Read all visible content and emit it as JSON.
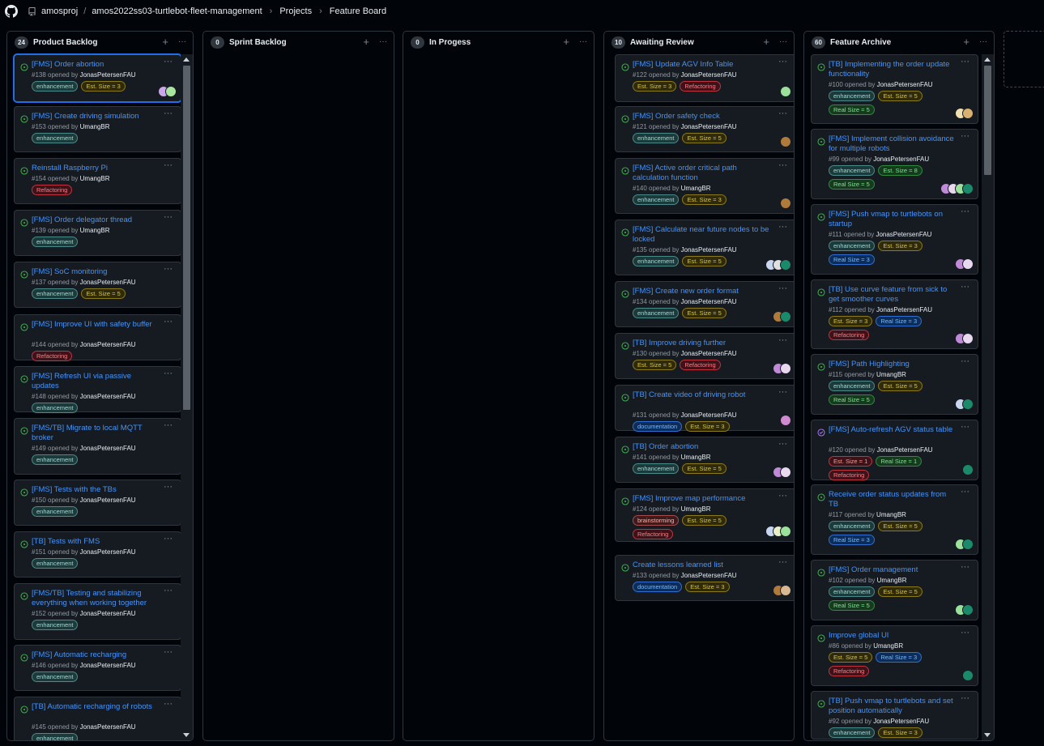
{
  "header": {
    "owner": "amosproj",
    "repo": "amos2022ss03-turtlebot-fleet-management",
    "crumbs": [
      "Projects",
      "Feature Board"
    ]
  },
  "columns": [
    {
      "count": "24",
      "title": "Product Backlog",
      "cards": [
        {
          "title": "[FMS] Order abortion",
          "num": "#138",
          "author": "JonasPetersenFAU",
          "labels": [
            [
              "enhancement",
              "enh"
            ],
            [
              "Est. Size = 3",
              "est"
            ]
          ],
          "avatars": [
            "#c9a7e8",
            "#a8e6a0"
          ]
        },
        {
          "title": "[FMS] Create driving simulation",
          "num": "#153",
          "author": "UmangBR",
          "labels": [
            [
              "enhancement",
              "enh"
            ]
          ],
          "avatars": []
        },
        {
          "title": "Reinstall Raspberry Pi",
          "num": "#154",
          "author": "UmangBR",
          "labels": [
            [
              "Refactoring",
              "ref"
            ]
          ],
          "avatars": []
        },
        {
          "title": "[FMS] Order delegator thread",
          "num": "#139",
          "author": "UmangBR",
          "labels": [
            [
              "enhancement",
              "enh"
            ]
          ],
          "avatars": []
        },
        {
          "title": "[FMS] SoC monitoring",
          "num": "#137",
          "author": "JonasPetersenFAU",
          "labels": [
            [
              "enhancement",
              "enh"
            ],
            [
              "Est. Size = 5",
              "est"
            ]
          ],
          "avatars": []
        },
        {
          "title": "[FMS] Improve UI with safety buffer",
          "num": "#144",
          "author": "JonasPetersenFAU",
          "labels": [
            [
              "Refactoring",
              "ref"
            ]
          ],
          "avatars": []
        },
        {
          "title": "[FMS] Refresh UI via passive updates",
          "num": "#148",
          "author": "JonasPetersenFAU",
          "labels": [
            [
              "enhancement",
              "enh"
            ]
          ],
          "avatars": []
        },
        {
          "title": "[FMS/TB] Migrate to local MQTT broker",
          "num": "#149",
          "author": "JonasPetersenFAU",
          "labels": [
            [
              "enhancement",
              "enh"
            ]
          ],
          "avatars": []
        },
        {
          "title": "[FMS] Tests with the TBs",
          "num": "#150",
          "author": "JonasPetersenFAU",
          "labels": [
            [
              "enhancement",
              "enh"
            ]
          ],
          "avatars": []
        },
        {
          "title": "[TB] Tests with FMS",
          "num": "#151",
          "author": "JonasPetersenFAU",
          "labels": [
            [
              "enhancement",
              "enh"
            ]
          ],
          "avatars": []
        },
        {
          "title": "[FMS/TB] Testing and stabilizing everything when working together",
          "num": "#152",
          "author": "JonasPetersenFAU",
          "labels": [
            [
              "enhancement",
              "enh"
            ]
          ],
          "avatars": []
        },
        {
          "title": "[FMS] Automatic recharging",
          "num": "#146",
          "author": "JonasPetersenFAU",
          "labels": [
            [
              "enhancement",
              "enh"
            ]
          ],
          "avatars": []
        },
        {
          "title": "[TB] Automatic recharging of robots",
          "num": "#145",
          "author": "JonasPetersenFAU",
          "labels": [
            [
              "enhancement",
              "enh"
            ]
          ],
          "avatars": []
        }
      ]
    },
    {
      "count": "0",
      "title": "Sprint Backlog",
      "cards": []
    },
    {
      "count": "0",
      "title": "In Progess",
      "cards": []
    },
    {
      "count": "10",
      "title": "Awaiting Review",
      "cards": [
        {
          "title": "[FMS] Update AGV Info Table",
          "num": "#122",
          "author": "JonasPetersenFAU",
          "labels": [
            [
              "Est. Size = 3",
              "est"
            ],
            [
              "Refactoring",
              "ref"
            ]
          ],
          "avatars": [
            "#9be09b"
          ]
        },
        {
          "title": "[FMS] Order safety check",
          "num": "#121",
          "author": "JonasPetersenFAU",
          "labels": [
            [
              "enhancement",
              "enh"
            ],
            [
              "Est. Size = 5",
              "est"
            ]
          ],
          "avatars": [
            "#b07a3a"
          ]
        },
        {
          "title": "[FMS] Active order critical path calculation function",
          "num": "#140",
          "author": "UmangBR",
          "labels": [
            [
              "enhancement",
              "enh"
            ],
            [
              "Est. Size = 3",
              "est"
            ]
          ],
          "avatars": [
            "#b07a3a"
          ]
        },
        {
          "title": "[FMS] Calculate near future nodes to be locked",
          "num": "#135",
          "author": "JonasPetersenFAU",
          "labels": [
            [
              "enhancement",
              "enh"
            ],
            [
              "Est. Size = 5",
              "est"
            ]
          ],
          "avatars": [
            "#c9d6f0",
            "#e0e0e0",
            "#1a8a6a"
          ]
        },
        {
          "title": "[FMS] Create new order format",
          "num": "#134",
          "author": "JonasPetersenFAU",
          "labels": [
            [
              "enhancement",
              "enh"
            ],
            [
              "Est. Size = 5",
              "est"
            ]
          ],
          "avatars": [
            "#b07a3a",
            "#1a8a6a"
          ]
        },
        {
          "title": "[TB] Improve driving further",
          "num": "#130",
          "author": "JonasPetersenFAU",
          "labels": [
            [
              "Est. Size = 5",
              "est"
            ],
            [
              "Refactoring",
              "ref"
            ]
          ],
          "avatars": [
            "#c08ad8",
            "#e8d8f0"
          ]
        },
        {
          "title": "[TB] Create video of driving robot",
          "num": "#131",
          "author": "JonasPetersenFAU",
          "labels": [
            [
              "documentation",
              "doc"
            ],
            [
              "Est. Size = 3",
              "est"
            ]
          ],
          "avatars": [
            "#d08ad0"
          ]
        },
        {
          "title": "[TB] Order abortion",
          "num": "#141",
          "author": "UmangBR",
          "labels": [
            [
              "enhancement",
              "enh"
            ],
            [
              "Est. Size = 5",
              "est"
            ]
          ],
          "avatars": [
            "#c08ad8",
            "#e8d8f0"
          ]
        },
        {
          "title": "[FMS] Improve map performance",
          "num": "#124",
          "author": "UmangBR",
          "labels": [
            [
              "brainstorming",
              "brain"
            ],
            [
              "Est. Size = 5",
              "est"
            ],
            [
              "Refactoring",
              "ref"
            ]
          ],
          "avatars": [
            "#c9d6f0",
            "#e8f0c9",
            "#9be09b"
          ]
        },
        {
          "title": "Create lessons learned list",
          "num": "#133",
          "author": "JonasPetersenFAU",
          "labels": [
            [
              "documentation",
              "doc"
            ],
            [
              "Est. Size = 3",
              "est"
            ]
          ],
          "avatars": [
            "#b07a3a",
            "#d8b890"
          ]
        }
      ]
    },
    {
      "count": "60",
      "title": "Feature Archive",
      "cards": [
        {
          "title": "[TB] Implementing the order update functionality",
          "num": "#100",
          "author": "JonasPetersenFAU",
          "labels": [
            [
              "enhancement",
              "enh"
            ],
            [
              "Est. Size = 5",
              "est"
            ],
            [
              "Real Size = 5",
              "realg"
            ]
          ],
          "avatars": [
            "#f0e0b0",
            "#d8b070"
          ]
        },
        {
          "title": "[FMS] Implement collision avoidance for multiple robots",
          "num": "#99",
          "author": "JonasPetersenFAU",
          "labels": [
            [
              "enhancement",
              "enh"
            ],
            [
              "Est. Size = 8",
              "realg"
            ],
            [
              "Real Size = 5",
              "realg"
            ]
          ],
          "avatars": [
            "#c08ad8",
            "#e8d8f0",
            "#9be09b",
            "#1a8a6a"
          ]
        },
        {
          "title": "[FMS] Push vmap to turtlebots on startup",
          "num": "#111",
          "author": "JonasPetersenFAU",
          "labels": [
            [
              "enhancement",
              "enh"
            ],
            [
              "Est. Size = 3",
              "est"
            ],
            [
              "Real Size = 3",
              "realb"
            ]
          ],
          "avatars": [
            "#c08ad8",
            "#e8d8f0"
          ]
        },
        {
          "title": "[TB] Use curve feature from sick to get smoother curves",
          "num": "#112",
          "author": "JonasPetersenFAU",
          "labels": [
            [
              "Est. Size = 3",
              "est"
            ],
            [
              "Real Size = 3",
              "realb"
            ],
            [
              "Refactoring",
              "ref"
            ]
          ],
          "avatars": [
            "#c08ad8",
            "#e8d8f0"
          ]
        },
        {
          "title": "[FMS] Path Highlighting",
          "num": "#115",
          "author": "UmangBR",
          "labels": [
            [
              "enhancement",
              "enh"
            ],
            [
              "Est. Size = 5",
              "est"
            ],
            [
              "Real Size = 5",
              "realg"
            ]
          ],
          "avatars": [
            "#c9d6f0",
            "#1a8a6a"
          ]
        },
        {
          "title": "[FMS] Auto-refresh AGV status table",
          "num": "#120",
          "author": "JonasPetersenFAU",
          "labels": [
            [
              "Est. Size = 1",
              "est1"
            ],
            [
              "Real Size = 1",
              "realg"
            ],
            [
              "Refactoring",
              "ref"
            ]
          ],
          "avatars": [
            "#1a8a6a"
          ],
          "closed": true
        },
        {
          "title": "Receive order status updates from TB",
          "num": "#117",
          "author": "UmangBR",
          "labels": [
            [
              "enhancement",
              "enh"
            ],
            [
              "Est. Size = 5",
              "est"
            ],
            [
              "Real Size = 3",
              "realb"
            ]
          ],
          "avatars": [
            "#9be09b",
            "#1a8a6a"
          ]
        },
        {
          "title": "[FMS] Order management",
          "num": "#102",
          "author": "UmangBR",
          "labels": [
            [
              "enhancement",
              "enh"
            ],
            [
              "Est. Size = 5",
              "est"
            ],
            [
              "Real Size = 5",
              "realg"
            ]
          ],
          "avatars": [
            "#9be09b",
            "#1a8a6a"
          ]
        },
        {
          "title": "Improve global UI",
          "num": "#86",
          "author": "UmangBR",
          "labels": [
            [
              "Est. Size = 5",
              "est"
            ],
            [
              "Real Size = 3",
              "realb"
            ],
            [
              "Refactoring",
              "ref"
            ]
          ],
          "avatars": [
            "#1a8a6a"
          ]
        },
        {
          "title": "[TB] Push vmap to turtlebots and set position automatically",
          "num": "#92",
          "author": "JonasPetersenFAU",
          "labels": [
            [
              "enhancement",
              "enh"
            ],
            [
              "Est. Size = 3",
              "est"
            ]
          ],
          "avatars": []
        }
      ]
    }
  ],
  "ui": {
    "opened_by": "opened by",
    "add_glyph": "+",
    "more_glyph": "···"
  }
}
